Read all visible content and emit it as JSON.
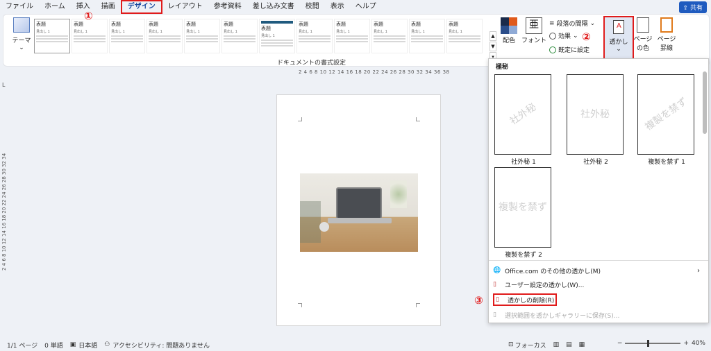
{
  "menu": {
    "tabs": [
      "ファイル",
      "ホーム",
      "挿入",
      "描画",
      "デザイン",
      "レイアウト",
      "参考資料",
      "差し込み文書",
      "校閲",
      "表示",
      "ヘルプ"
    ],
    "active": "デザイン",
    "share": "共有"
  },
  "ribbon": {
    "theme_label": "テーマ",
    "style_cards": [
      {
        "title": "表題",
        "sub": "見出し 1"
      },
      {
        "title": "表題",
        "sub": "見出し 1"
      },
      {
        "title": "表題",
        "sub": "見出し 1"
      },
      {
        "title": "表題",
        "sub": "見出し 1"
      },
      {
        "title": "表題",
        "sub": "見出し 1"
      },
      {
        "title": "表題",
        "sub": "見出し 1"
      },
      {
        "title": "表題",
        "sub": "見出し 1"
      },
      {
        "title": "表題",
        "sub": "見出し 1"
      },
      {
        "title": "表題",
        "sub": "見出し 1"
      },
      {
        "title": "表題",
        "sub": "見出し 1"
      },
      {
        "title": "表題",
        "sub": "見出し 1"
      },
      {
        "title": "表題",
        "sub": "見出し 1"
      }
    ],
    "group_label": "ドキュメントの書式設定",
    "colors_label": "配色",
    "font_label": "フォント",
    "font_glyph": "亜",
    "paragraph_spacing": "段落の間隔",
    "effects": "効果",
    "set_default": "既定に設定",
    "watermark": "透かし",
    "page_color": "ページの色",
    "page_border": "ページ罫線"
  },
  "annotations": [
    "①",
    "②",
    "③"
  ],
  "ruler": {
    "top": "2 4 6 8 10 12 14 16 18 20 22 24 26 28 30 32 34 36 38",
    "left": "2 4 6 8 10 12 14 16 18 20 22 24 26 28 30 32 34",
    "left_mark": "L"
  },
  "dropdown": {
    "heading": "極秘",
    "items": [
      {
        "text": "社外秘",
        "caption": "社外秘 1",
        "diagonal": true
      },
      {
        "text": "社外秘",
        "caption": "社外秘 2",
        "diagonal": false
      },
      {
        "text": "複製を禁ず",
        "caption": "複製を禁ず 1",
        "diagonal": true
      },
      {
        "text": "複製を禁ず",
        "caption": "複製を禁ず 2",
        "diagonal": false
      }
    ],
    "menu": [
      {
        "label": "Office.com のその他の透かし(M)",
        "has_sub": true,
        "disabled": false
      },
      {
        "label": "ユーザー設定の透かし(W)...",
        "has_sub": false,
        "disabled": false
      },
      {
        "label": "透かしの削除(R)",
        "has_sub": false,
        "disabled": false
      },
      {
        "label": "選択範囲を透かしギャラリーに保存(S)...",
        "has_sub": false,
        "disabled": true
      }
    ]
  },
  "status": {
    "page": "1/1 ページ",
    "words": "0 単語",
    "lang": "日本語",
    "access": "アクセシビリティ: 問題ありません",
    "focus": "フォーカス",
    "zoom_percent": "40%",
    "zoom_fraction": 0.4
  },
  "colors": {
    "accent": "#1f5bbf",
    "highlight": "#e01b1b"
  }
}
